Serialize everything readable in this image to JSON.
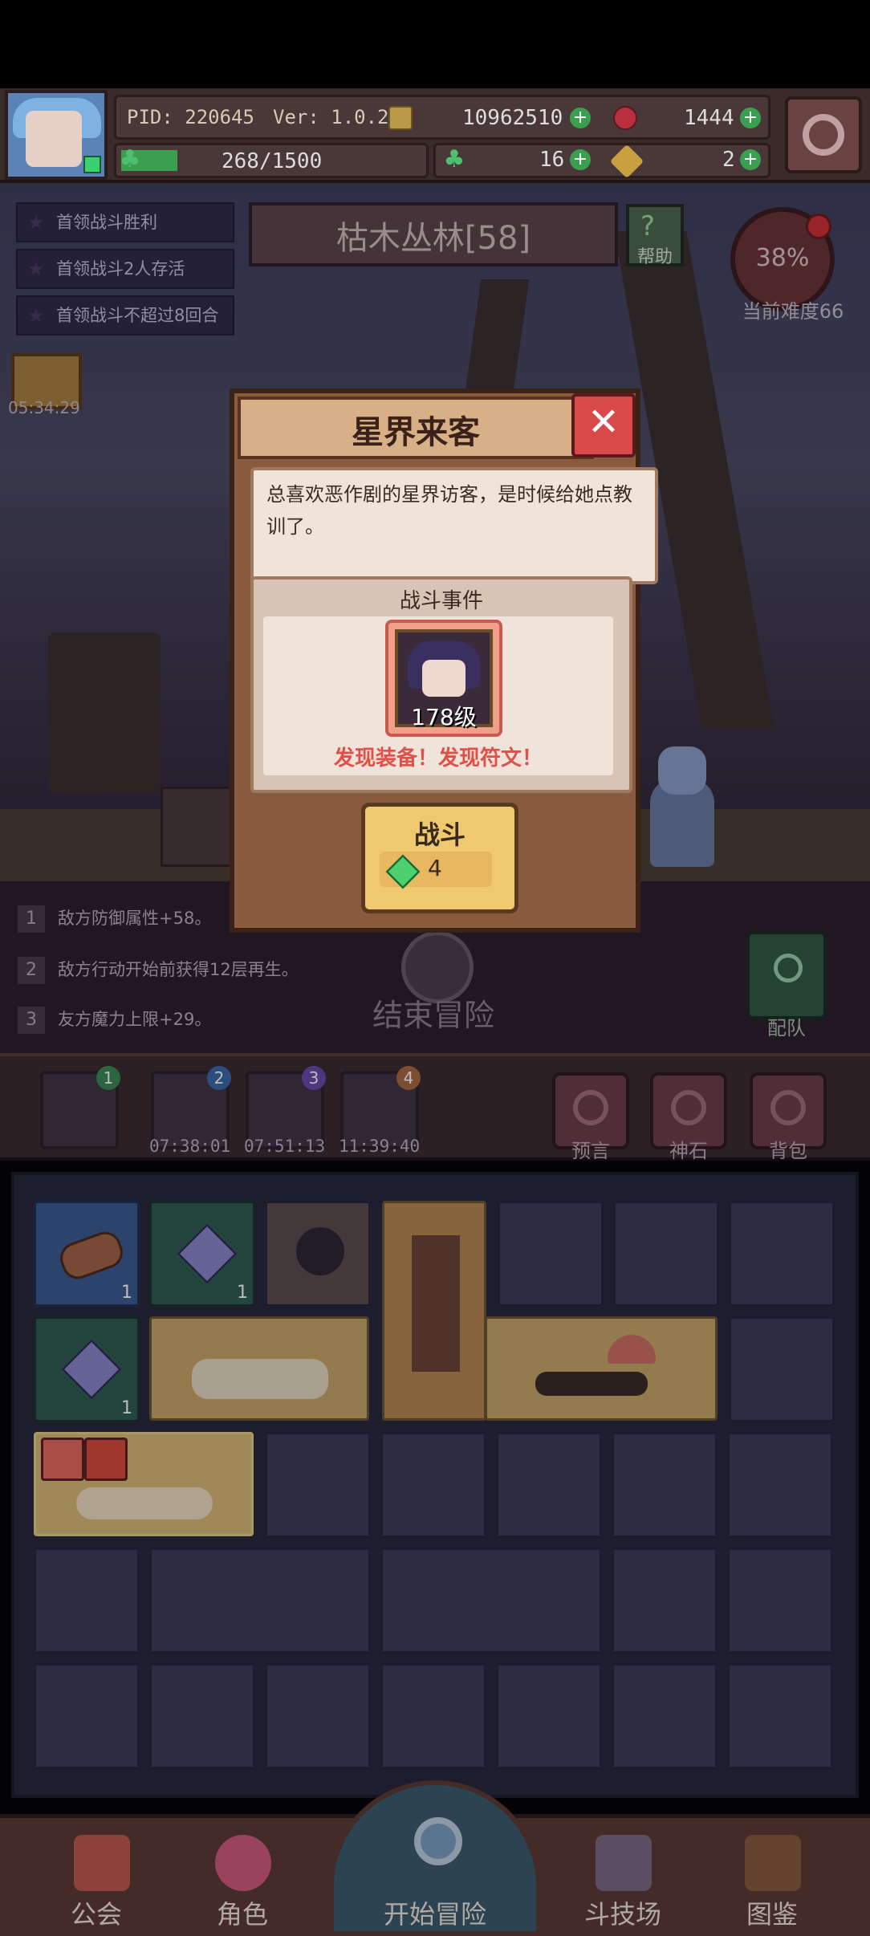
{
  "header": {
    "pid_label": "PID: 220645",
    "version_label": "Ver: 1.0.2.0",
    "gold": "10962510",
    "ruby": "1444",
    "stamina": "268/1500",
    "clover": "16",
    "key": "2",
    "plus": "+"
  },
  "quests": [
    {
      "label": "首领战斗胜利"
    },
    {
      "label": "首领战斗2人存活"
    },
    {
      "label": "首领战斗不超过8回合"
    }
  ],
  "location": {
    "title": "枯木丛林[58]"
  },
  "help": {
    "label": "帮助",
    "icon_char": "?"
  },
  "difficulty": {
    "percent": "38%",
    "label": "当前难度66"
  },
  "chest_timer": "05:34:29",
  "buffs": [
    {
      "num": "1",
      "text": "敌方防御属性+58。"
    },
    {
      "num": "2",
      "text": "敌方行动开始前获得12层再生。"
    },
    {
      "num": "3",
      "text": "友方魔力上限+29。"
    }
  ],
  "end_adventure": {
    "label": "结束冒险"
  },
  "team": {
    "label": "配队"
  },
  "shelf": {
    "slots": [
      {
        "badge": "1",
        "time": ""
      },
      {
        "badge": "2",
        "time": "07:38:01"
      },
      {
        "badge": "3",
        "time": "07:51:13"
      },
      {
        "badge": "4",
        "time": "11:39:40"
      }
    ],
    "buttons": [
      {
        "label": "预言"
      },
      {
        "label": "神石"
      },
      {
        "label": "背包"
      }
    ]
  },
  "inventory": {
    "counts": [
      "1",
      "1",
      "1"
    ]
  },
  "nav": {
    "guild": "公会",
    "character": "角色",
    "start": "开始冒险",
    "arena": "斗技场",
    "codex": "图鉴"
  },
  "modal": {
    "title": "星界来客",
    "close": "✕",
    "description": "总喜欢恶作剧的星界访客，是时候给她点教训了。",
    "event_label": "战斗事件",
    "level": "178级",
    "finds": "发现装备！发现符文！",
    "fight_label": "战斗",
    "fight_cost": "4"
  },
  "colors": {
    "accent_red": "#d84a4a",
    "gem_green": "#4cd070",
    "panel_brown": "#8a5a3e"
  }
}
